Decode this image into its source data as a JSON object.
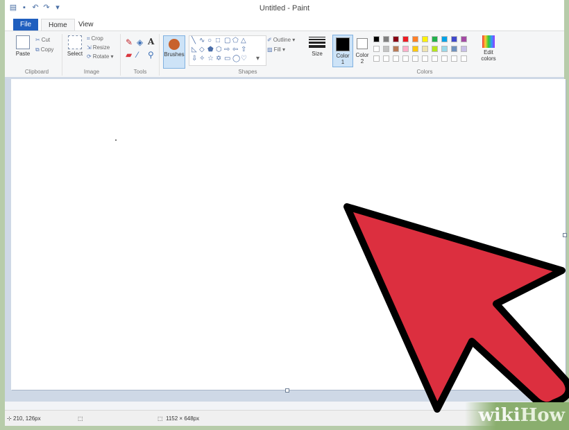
{
  "window": {
    "title": "Untitled - Paint"
  },
  "tabs": [
    {
      "label": "File"
    },
    {
      "label": "Home"
    },
    {
      "label": "View"
    }
  ],
  "ribbon": {
    "clipboard": {
      "paste": "Paste",
      "cut": "Cut",
      "copy": "Copy",
      "group": "Clipboard"
    },
    "image": {
      "select": "Select",
      "crop": "Crop",
      "resize": "Resize",
      "rotate": "Rotate ▾",
      "group": "Image"
    },
    "tools": {
      "group": "Tools"
    },
    "brushes": {
      "label": "Brushes"
    },
    "shapes": {
      "outline": "Outline ▾",
      "fill": "Fill ▾",
      "group": "Shapes"
    },
    "size": {
      "label": "Size"
    },
    "color1": {
      "label": "Color",
      "num": "1"
    },
    "color2": {
      "label": "Color",
      "num": "2"
    },
    "colors": {
      "group": "Colors"
    },
    "edit_colors": {
      "line1": "Edit",
      "line2": "colors"
    }
  },
  "palette": {
    "row1": [
      "#000000",
      "#7f7f7f",
      "#880015",
      "#ed1c24",
      "#ff7f27",
      "#fff200",
      "#22b14c",
      "#00a2e8",
      "#3f48cc",
      "#a349a4"
    ],
    "row2": [
      "#ffffff",
      "#c3c3c3",
      "#b97a57",
      "#ffaec9",
      "#ffc90e",
      "#efe4b0",
      "#b5e61d",
      "#99d9ea",
      "#7092be",
      "#c8bfe7"
    ],
    "row3_count": 10
  },
  "status": {
    "cursor": "210, 126px",
    "canvas_size": "1152 × 648px"
  },
  "annotation_arrow": {
    "color": "#dc2f3f"
  },
  "watermark": {
    "part1": "wiki",
    "part2": "How"
  }
}
